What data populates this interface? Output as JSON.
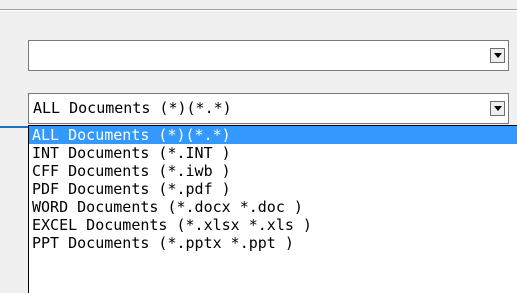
{
  "combo_path": {
    "value": ""
  },
  "combo_filter": {
    "value": "ALL Documents (*)(*.*)"
  },
  "dropdown": {
    "selected_index": 0,
    "items": [
      {
        "label": "ALL Documents (*)(*.*)"
      },
      {
        "label": "INT Documents (*.INT )"
      },
      {
        "label": "CFF Documents (*.iwb )"
      },
      {
        "label": "PDF Documents (*.pdf )"
      },
      {
        "label": "WORD Documents (*.docx *.doc )"
      },
      {
        "label": "EXCEL Documents (*.xlsx *.xls )"
      },
      {
        "label": "PPT Documents (*.pptx *.ppt )"
      }
    ]
  },
  "colors": {
    "selection": "#3399ff",
    "accent_line": "#1e73be"
  },
  "icons": {
    "dropdown_arrow": "chevron-down-icon"
  }
}
